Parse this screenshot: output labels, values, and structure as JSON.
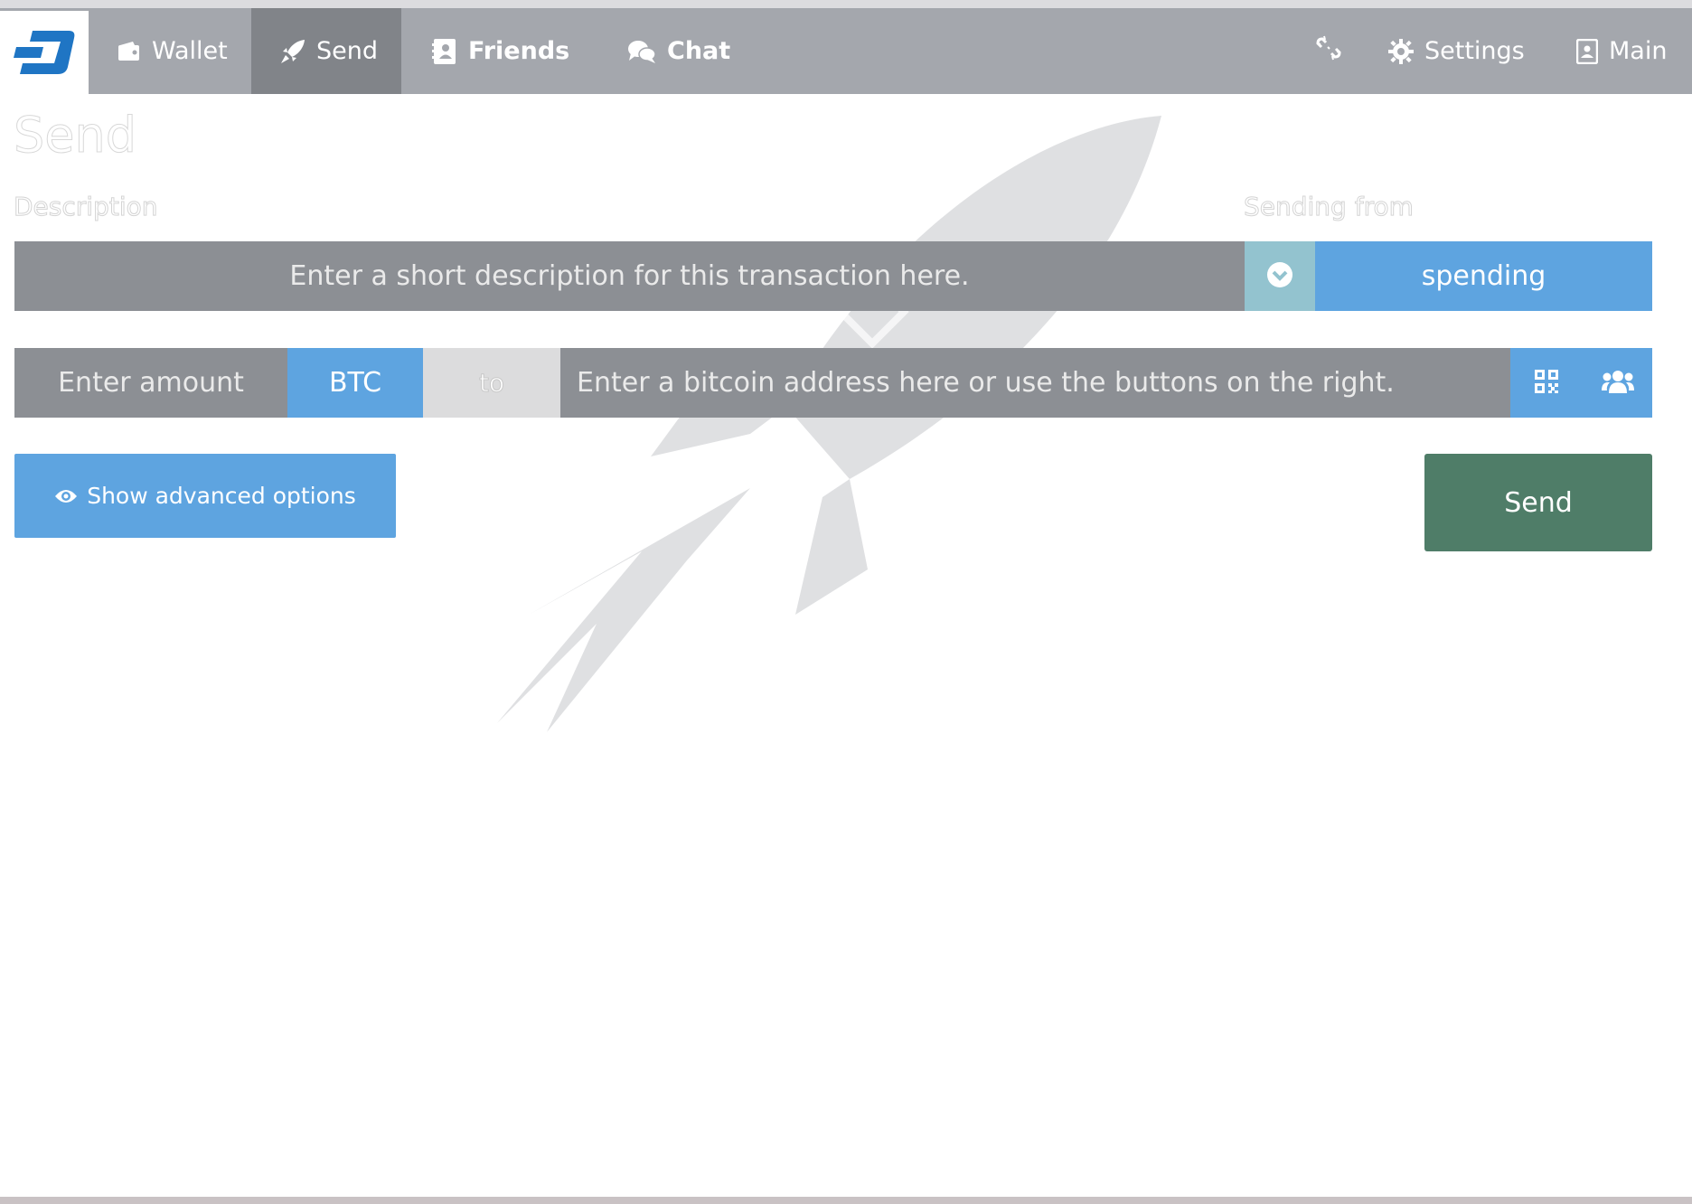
{
  "nav": {
    "items": [
      {
        "label": "Wallet",
        "icon": "wallet-icon"
      },
      {
        "label": "Send",
        "icon": "rocket-icon",
        "active": true
      },
      {
        "label": "Friends",
        "icon": "address-book-icon"
      },
      {
        "label": "Chat",
        "icon": "chat-bubbles-icon"
      }
    ],
    "right": [
      {
        "label": "",
        "icon": "disconnect-icon"
      },
      {
        "label": "Settings",
        "icon": "gear-icon"
      },
      {
        "label": "Main",
        "icon": "identity-card-icon"
      }
    ]
  },
  "page": {
    "title": "Send",
    "description_label": "Description",
    "sending_from_label": "Sending from"
  },
  "form": {
    "description_placeholder": "Enter a short description for this transaction here.",
    "account": "spending",
    "amount_placeholder": "Enter amount",
    "currency": "BTC",
    "to_label": "to",
    "address_placeholder": "Enter a bitcoin address here or use the buttons on the right."
  },
  "actions": {
    "advanced_label": "Show advanced options",
    "send_label": "Send"
  },
  "colors": {
    "nav_bg": "#a4a7ad",
    "nav_active": "#818489",
    "input_bg": "#8c8f94",
    "accent_blue": "#5ea4e0",
    "send_green": "#4f7d68",
    "dropdown_teal": "#93c3cf"
  }
}
